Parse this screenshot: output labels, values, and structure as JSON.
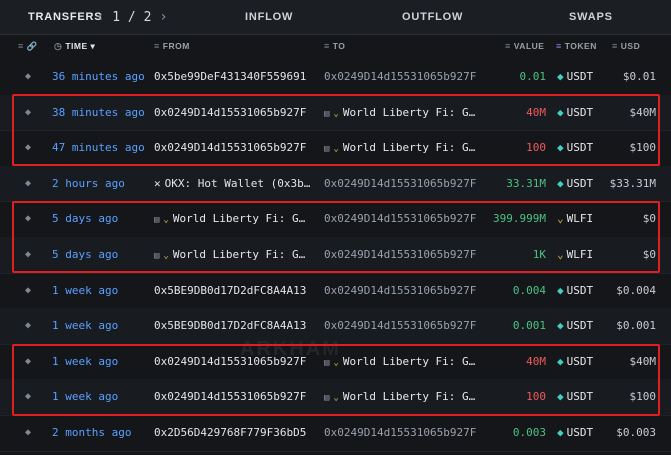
{
  "tabs": {
    "transfers": "TRANSFERS",
    "page": "1 / 2",
    "inflow": "INFLOW",
    "outflow": "OUTFLOW",
    "swaps": "SWAPS"
  },
  "columns": {
    "time": "TIME",
    "from": "FROM",
    "to": "TO",
    "value": "VALUE",
    "token": "TOKEN",
    "usd": "USD"
  },
  "watermark": "ARKHAM",
  "colors": {
    "positive": "#4cc281",
    "negative": "#f05a5a",
    "link": "#5aa0ff",
    "highlight": "#e0201f"
  },
  "rows": [
    {
      "time": "36 minutes ago",
      "from": "0x5be99DeF431340F559691",
      "to": "0x0249D14d15531065b927F",
      "value": "0.01",
      "value_color": "green",
      "token": "USDT",
      "usd": "$0.01"
    },
    {
      "time": "38 minutes ago",
      "from": "0x0249D14d15531065b927F",
      "to": "World Liberty Fi: G…",
      "value": "40M",
      "value_color": "red",
      "token": "USDT",
      "usd": "$40M"
    },
    {
      "time": "47 minutes ago",
      "from": "0x0249D14d15531065b927F",
      "to": "World Liberty Fi: G…",
      "value": "100",
      "value_color": "red",
      "token": "USDT",
      "usd": "$100"
    },
    {
      "time": "2 hours ago",
      "from": "OKX: Hot Wallet (0x3b…",
      "to": "0x0249D14d15531065b927F",
      "value": "33.31M",
      "value_color": "green",
      "token": "USDT",
      "usd": "$33.31M"
    },
    {
      "time": "5 days ago",
      "from": "World Liberty Fi: G…",
      "to": "0x0249D14d15531065b927F",
      "value": "399.999M",
      "value_color": "green",
      "token": "WLFI",
      "usd": "$0"
    },
    {
      "time": "5 days ago",
      "from": "World Liberty Fi: G…",
      "to": "0x0249D14d15531065b927F",
      "value": "1K",
      "value_color": "green",
      "token": "WLFI",
      "usd": "$0"
    },
    {
      "time": "1 week ago",
      "from": "0x5BE9DB0d17D2dFC8A4A13",
      "to": "0x0249D14d15531065b927F",
      "value": "0.004",
      "value_color": "green",
      "token": "USDT",
      "usd": "$0.004"
    },
    {
      "time": "1 week ago",
      "from": "0x5BE9DB0d17D2dFC8A4A13",
      "to": "0x0249D14d15531065b927F",
      "value": "0.001",
      "value_color": "green",
      "token": "USDT",
      "usd": "$0.001"
    },
    {
      "time": "1 week ago",
      "from": "0x0249D14d15531065b927F",
      "to": "World Liberty Fi: G…",
      "value": "40M",
      "value_color": "red",
      "token": "USDT",
      "usd": "$40M"
    },
    {
      "time": "1 week ago",
      "from": "0x0249D14d15531065b927F",
      "to": "World Liberty Fi: G…",
      "value": "100",
      "value_color": "red",
      "token": "USDT",
      "usd": "$100"
    },
    {
      "time": "2 months ago",
      "from": "0x2D56D429768F779F36bD5",
      "to": "0x0249D14d15531065b927F",
      "value": "0.003",
      "value_color": "green",
      "token": "USDT",
      "usd": "$0.003"
    }
  ]
}
